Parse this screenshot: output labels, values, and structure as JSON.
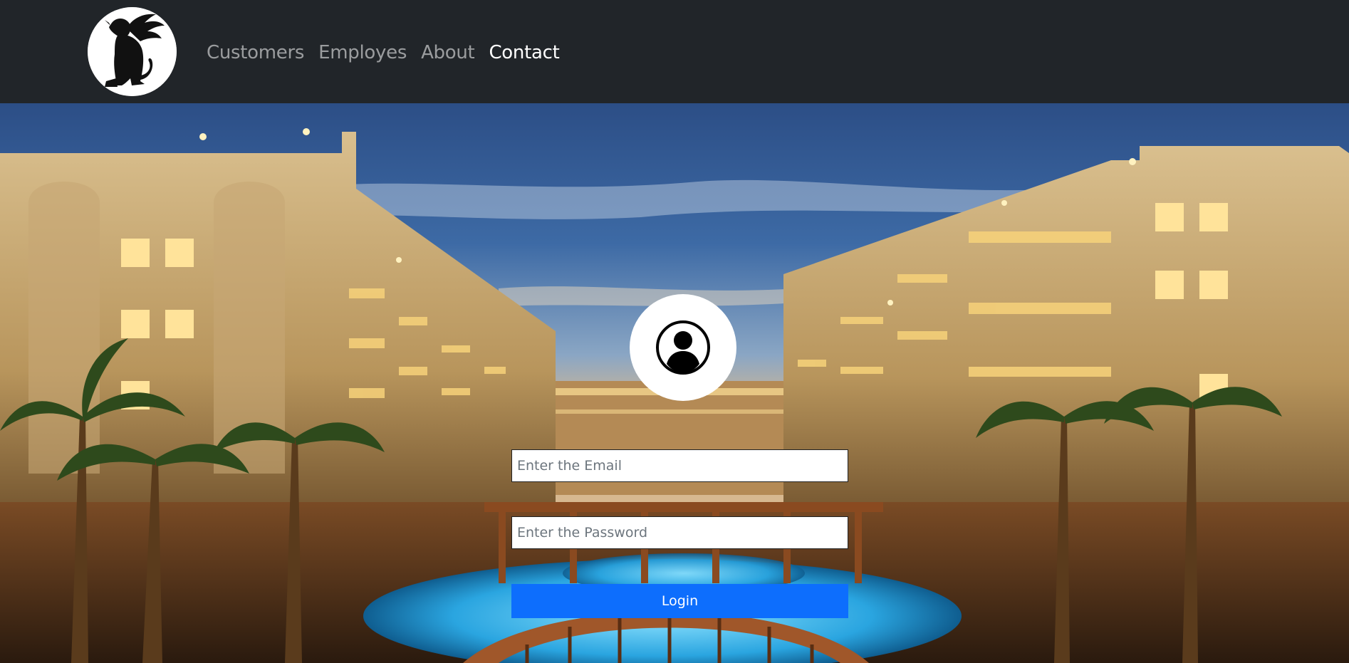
{
  "header": {
    "logo_icon": "winged-lion-logo-icon",
    "nav": [
      {
        "label": "Customers",
        "active": false
      },
      {
        "label": "Employes",
        "active": false
      },
      {
        "label": "About",
        "active": false
      },
      {
        "label": "Contact",
        "active": true
      }
    ]
  },
  "login": {
    "avatar_icon": "user-circle-icon",
    "email_placeholder": "Enter the Email",
    "password_placeholder": "Enter the Password",
    "submit_label": "Login"
  },
  "colors": {
    "navbar": "#212529",
    "nav_link": "rgba(255,255,255,0.55)",
    "nav_link_active": "#ffffff",
    "primary_button": "#0d6efd"
  }
}
